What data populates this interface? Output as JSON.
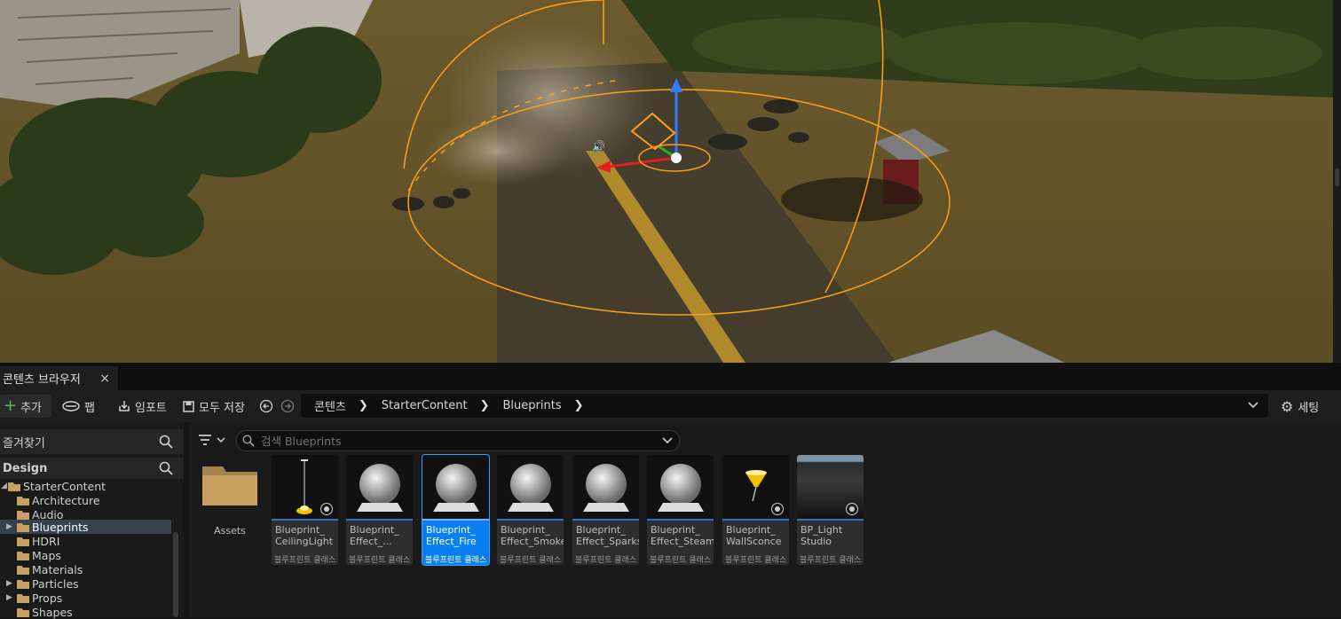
{
  "tab": {
    "title": "콘텐츠 브라우저",
    "close": "×"
  },
  "toolbar": {
    "add_label": "추가",
    "fab_label": "팹",
    "import_label": "임포트",
    "save_all_label": "모두 저장",
    "settings_label": "세팅"
  },
  "breadcrumb": {
    "items": [
      "콘텐츠",
      "StarterContent",
      "Blueprints"
    ]
  },
  "left_panel": {
    "favorites_label": "즐겨찾기",
    "design_label": "Design",
    "tree": [
      {
        "label": "StarterContent",
        "expanded": true,
        "has_children": true
      },
      {
        "label": "Architecture",
        "has_children": false
      },
      {
        "label": "Audio",
        "has_children": false
      },
      {
        "label": "Blueprints",
        "has_children": true,
        "selected": true
      },
      {
        "label": "HDRI",
        "has_children": false
      },
      {
        "label": "Maps",
        "has_children": false
      },
      {
        "label": "Materials",
        "has_children": false
      },
      {
        "label": "Particles",
        "has_children": true
      },
      {
        "label": "Props",
        "has_children": true
      },
      {
        "label": "Shapes",
        "has_children": false
      }
    ]
  },
  "content": {
    "search_placeholder": "검색 Blueprints",
    "folder": {
      "label": "Assets"
    },
    "assets": [
      {
        "name": "Blueprint_\nCeilingLight",
        "type": "블루프린트 클래스",
        "thumb": "ceiling-light"
      },
      {
        "name": "Blueprint_\nEffect_...",
        "type": "블루프린트 클래스",
        "thumb": "sphere"
      },
      {
        "name": "Blueprint_\nEffect_Fire",
        "type": "블루프린트 클래스",
        "thumb": "sphere",
        "selected": true
      },
      {
        "name": "Blueprint_\nEffect_Smoke",
        "type": "블루프린트 클래스",
        "thumb": "sphere"
      },
      {
        "name": "Blueprint_\nEffect_Sparks",
        "type": "블루프린트 클래스",
        "thumb": "sphere"
      },
      {
        "name": "Blueprint_\nEffect_Steam",
        "type": "블루프린트 클래스",
        "thumb": "sphere"
      },
      {
        "name": "Blueprint_\nWallSconce",
        "type": "블루프린트 클래스",
        "thumb": "wall-sconce"
      },
      {
        "name": "BP_Light\nStudio",
        "type": "블루프린트 클래스",
        "thumb": "light-studio"
      }
    ]
  },
  "colors": {
    "accent": "#0a7ff0",
    "add_green": "#4fbf4f",
    "folder": "#c8a060",
    "gizmo_orange": "#ff9f1a"
  }
}
